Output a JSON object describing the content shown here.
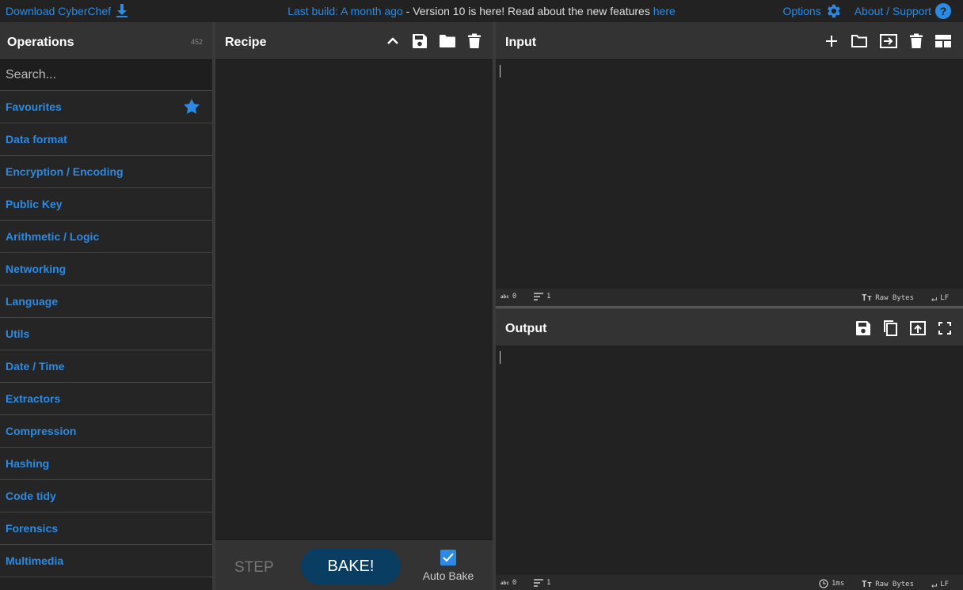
{
  "banner": {
    "download_label": "Download CyberChef",
    "last_build": "Last build: A month ago",
    "version_text": " - Version 10 is here! Read about the new features ",
    "here_link": "here",
    "options_label": "Options",
    "about_label": "About / Support"
  },
  "operations": {
    "title": "Operations",
    "count": "452",
    "search_placeholder": "Search...",
    "categories": [
      {
        "label": "Favourites"
      },
      {
        "label": "Data format"
      },
      {
        "label": "Encryption / Encoding"
      },
      {
        "label": "Public Key"
      },
      {
        "label": "Arithmetic / Logic"
      },
      {
        "label": "Networking"
      },
      {
        "label": "Language"
      },
      {
        "label": "Utils"
      },
      {
        "label": "Date / Time"
      },
      {
        "label": "Extractors"
      },
      {
        "label": "Compression"
      },
      {
        "label": "Hashing"
      },
      {
        "label": "Code tidy"
      },
      {
        "label": "Forensics"
      },
      {
        "label": "Multimedia"
      }
    ]
  },
  "recipe": {
    "title": "Recipe",
    "step_label": "STEP",
    "bake_label": "BAKE!",
    "auto_bake_label": "Auto Bake",
    "auto_bake_checked": true
  },
  "input": {
    "title": "Input",
    "status": {
      "chars": "0",
      "lines": "1",
      "encoding": "Raw Bytes",
      "eol": "LF"
    }
  },
  "output": {
    "title": "Output",
    "status": {
      "chars": "0",
      "lines": "1",
      "time": "1ms",
      "encoding": "Raw Bytes",
      "eol": "LF"
    }
  },
  "colors": {
    "accent": "#2b8ae4",
    "bake": "#0a3d62",
    "panel": "#333333",
    "background": "#222222"
  }
}
